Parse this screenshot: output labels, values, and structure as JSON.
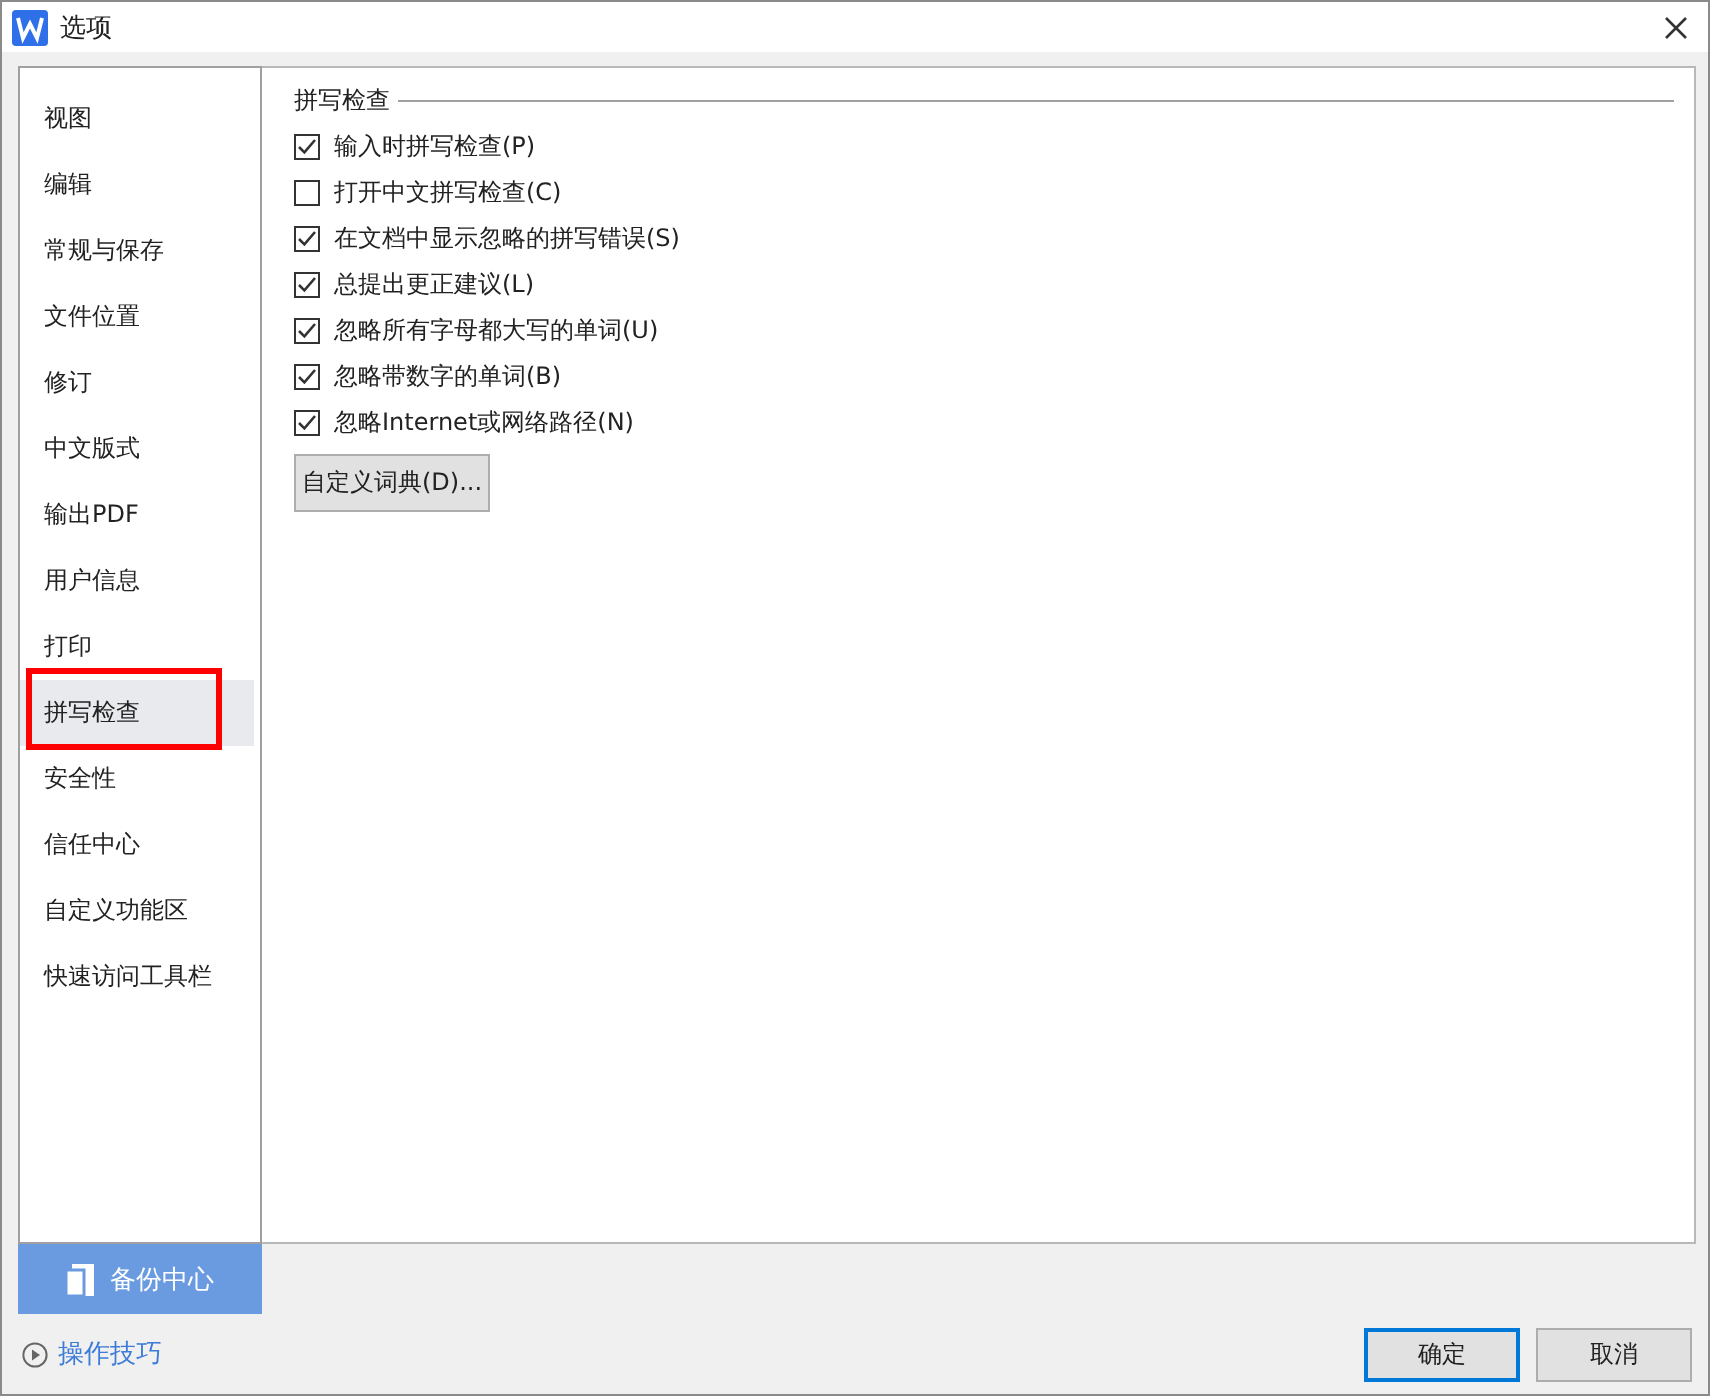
{
  "window": {
    "title": "选项"
  },
  "sidebar": {
    "items": [
      {
        "label": "视图",
        "selected": false,
        "annotated": false
      },
      {
        "label": "编辑",
        "selected": false,
        "annotated": false
      },
      {
        "label": "常规与保存",
        "selected": false,
        "annotated": false
      },
      {
        "label": "文件位置",
        "selected": false,
        "annotated": false
      },
      {
        "label": "修订",
        "selected": false,
        "annotated": false
      },
      {
        "label": "中文版式",
        "selected": false,
        "annotated": false
      },
      {
        "label": "输出PDF",
        "selected": false,
        "annotated": false
      },
      {
        "label": "用户信息",
        "selected": false,
        "annotated": false
      },
      {
        "label": "打印",
        "selected": false,
        "annotated": false
      },
      {
        "label": "拼写检查",
        "selected": true,
        "annotated": true
      },
      {
        "label": "安全性",
        "selected": false,
        "annotated": false
      },
      {
        "label": "信任中心",
        "selected": false,
        "annotated": false
      },
      {
        "label": "自定义功能区",
        "selected": false,
        "annotated": false
      },
      {
        "label": "快速访问工具栏",
        "selected": false,
        "annotated": false
      }
    ],
    "backup_button": "备份中心",
    "tips_link": "操作技巧"
  },
  "section": {
    "title": "拼写检查",
    "options": [
      {
        "label": "输入时拼写检查(P)",
        "checked": true
      },
      {
        "label": "打开中文拼写检查(C)",
        "checked": false
      },
      {
        "label": "在文档中显示忽略的拼写错误(S)",
        "checked": true
      },
      {
        "label": "总提出更正建议(L)",
        "checked": true
      },
      {
        "label": "忽略所有字母都大写的单词(U)",
        "checked": true
      },
      {
        "label": "忽略带数字的单词(B)",
        "checked": true
      },
      {
        "label": "忽略Internet或网络路径(N)",
        "checked": true
      }
    ],
    "dictionary_button": "自定义词典(D)..."
  },
  "buttons": [
    {
      "label": "确定",
      "default": true
    },
    {
      "label": "取消",
      "default": false
    }
  ]
}
